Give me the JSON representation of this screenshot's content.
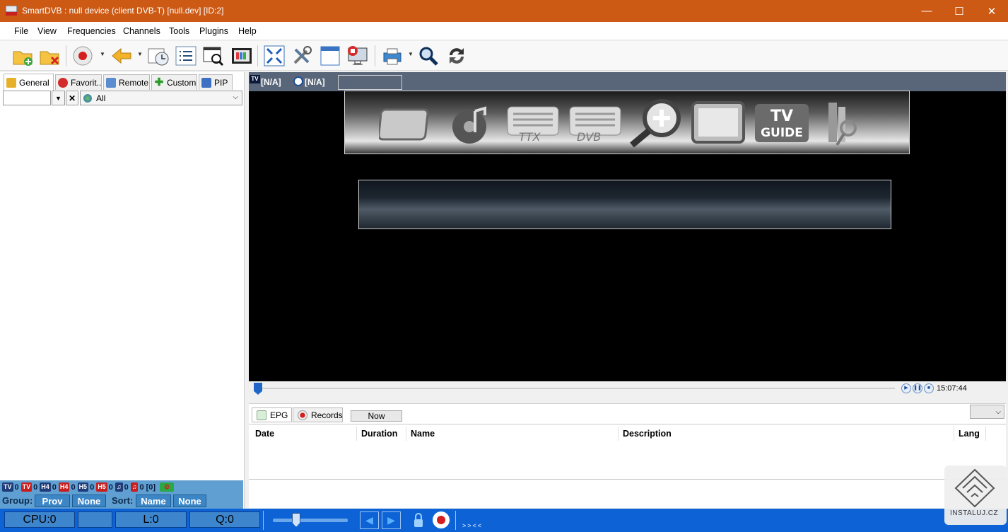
{
  "window": {
    "title": "SmartDVB : null device (client DVB-T) [null.dev]  [ID:2]",
    "minimize": "—",
    "maximize": "☐",
    "close": "✕"
  },
  "menu": [
    "File",
    "View",
    "Frequencies",
    "Channels",
    "Tools",
    "Plugins",
    "Help"
  ],
  "toolbar": [
    "open-folder",
    "remove-folder",
    "record",
    "back",
    "scheduler",
    "channel-list",
    "browser-search",
    "capture",
    "fullscreen",
    "tools",
    "window",
    "screen-record",
    "print",
    "search",
    "refresh"
  ],
  "left_tabs": [
    {
      "label": "General",
      "icon": "star",
      "color": "#e6b02a"
    },
    {
      "label": "Favorit...",
      "icon": "heart",
      "color": "#d32a2a"
    },
    {
      "label": "Remote",
      "icon": "remote",
      "color": "#5a8ccf"
    },
    {
      "label": "Custom",
      "icon": "plus",
      "color": "#2a9a2a"
    },
    {
      "label": "PIP",
      "icon": "pip",
      "color": "#3d6fc2"
    }
  ],
  "filter": {
    "search_value": "",
    "clear": "✕",
    "scope": "All"
  },
  "indicators": {
    "counts": [
      {
        "badge": "TV",
        "color": "#1f3d7a",
        "value": "0"
      },
      {
        "badge": "TV",
        "color": "#c81e1e",
        "value": "0"
      },
      {
        "badge": "H4",
        "color": "#1f3d7a",
        "value": "0"
      },
      {
        "badge": "H4",
        "color": "#c81e1e",
        "value": "0"
      },
      {
        "badge": "H5",
        "color": "#1f3d7a",
        "value": "0"
      },
      {
        "badge": "H5",
        "color": "#c81e1e",
        "value": "0"
      },
      {
        "badge": "♫",
        "color": "#1f3d7a",
        "value": "0"
      },
      {
        "badge": "♫",
        "color": "#c81e1e",
        "value": "0"
      }
    ],
    "total": "[0]"
  },
  "group": {
    "label": "Group:",
    "prov": "Prov",
    "none": "None",
    "sort_label": "Sort:",
    "name": "Name",
    "none2": "None"
  },
  "video": {
    "tv_label": "[N/A]",
    "radio_label": "[N/A]"
  },
  "player": {
    "time": "15:07:44"
  },
  "epg": {
    "tabs": [
      "EPG",
      "Records"
    ],
    "now": "Now",
    "columns": [
      "Date",
      "Duration",
      "Name",
      "Description",
      "Lang"
    ]
  },
  "bottom": {
    "cpu": "CPU:0",
    "l": "L:0",
    "q": "Q:0",
    "arrows": ">><<"
  },
  "watermark": "INSTALUJ.CZ"
}
